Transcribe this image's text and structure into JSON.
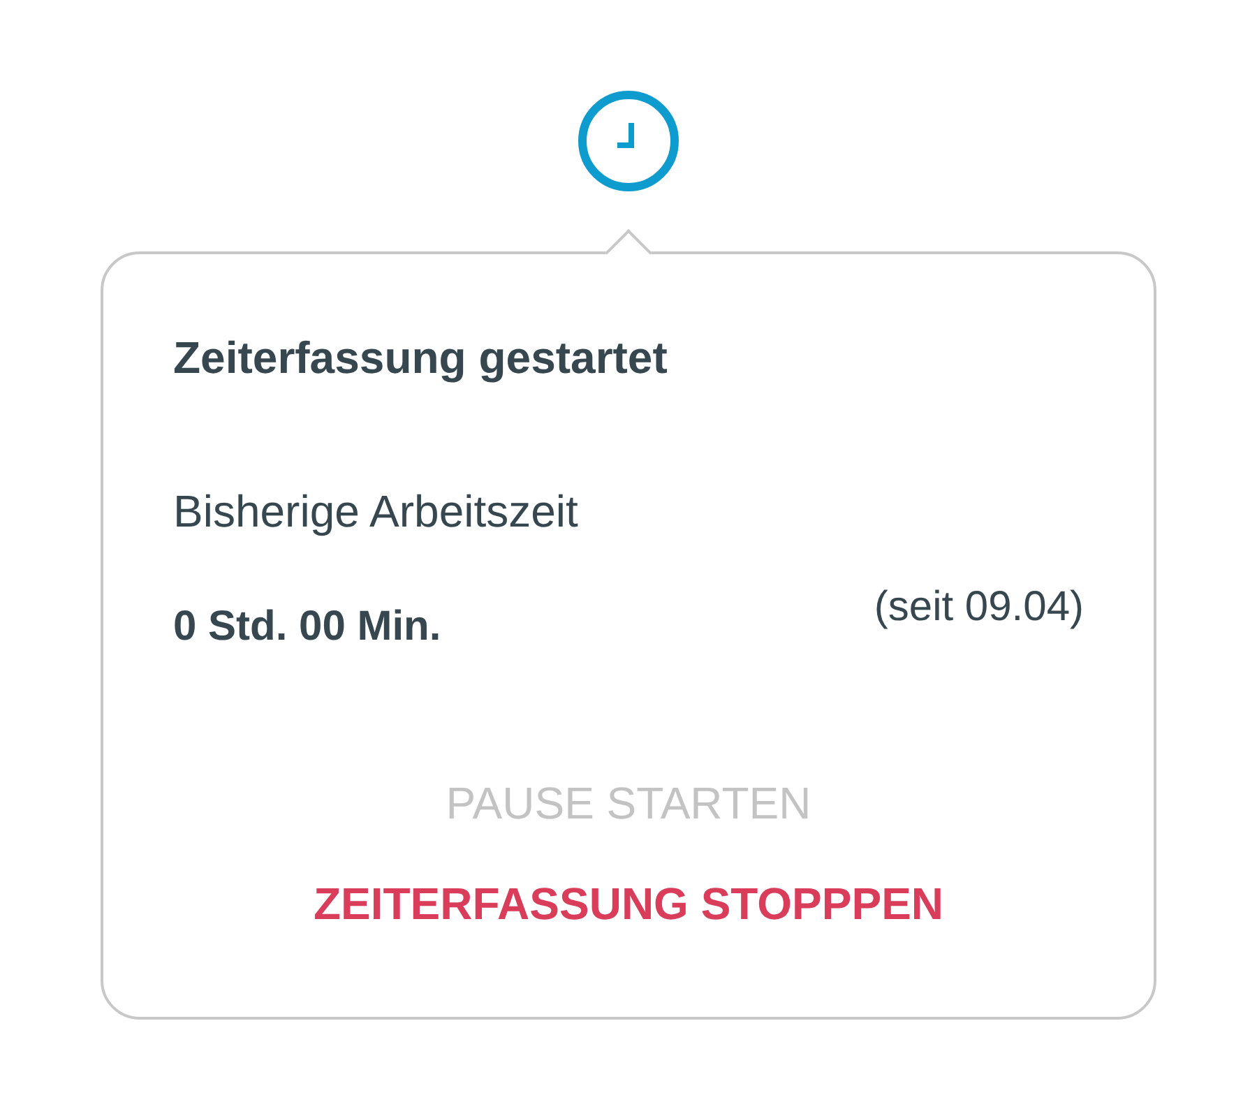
{
  "popup": {
    "title": "Zeiterfassung gestartet",
    "label": "Bisherige Arbeitszeit",
    "duration": "0 Std. 00 Min.",
    "since": "(seit 09.04)",
    "actions": [
      {
        "label": "PAUSE STARTEN",
        "kind": "pause",
        "disabled": true
      },
      {
        "label": "ZEITERFASSUNG STOPPPEN",
        "kind": "stop",
        "disabled": false
      }
    ]
  }
}
